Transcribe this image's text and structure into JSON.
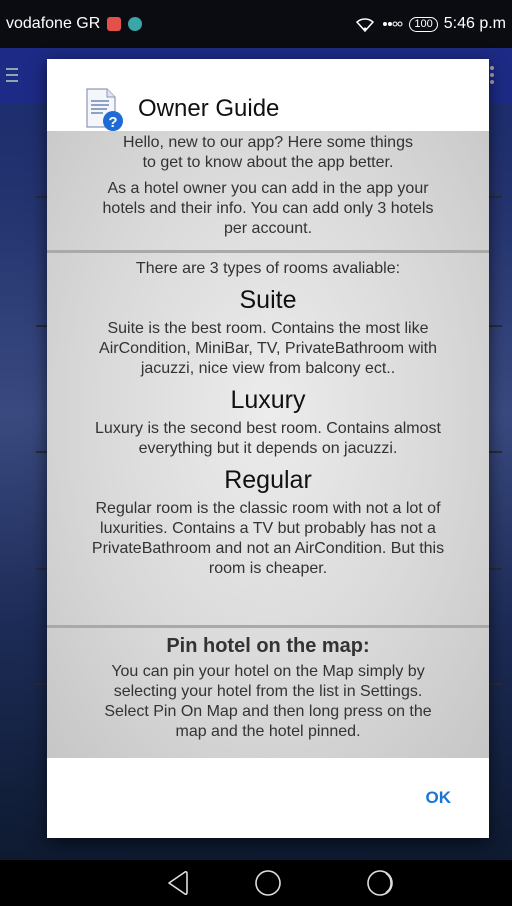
{
  "status_bar": {
    "carrier": "vodafone GR",
    "battery": "100",
    "time": "5:46 p.m"
  },
  "dialog": {
    "title": "Owner Guide",
    "intro": {
      "line1": "Hello, new to our app? Here some things",
      "line2": "to get to know about the app better.",
      "hotels_line1": "As a hotel owner you can add in the app your",
      "hotels_line2": "hotels and their info. You can add only 3 hotels",
      "hotels_line3": "per account."
    },
    "rooms": {
      "heading": "There are 3 types of rooms avaliable:",
      "suite": {
        "name": "Suite",
        "line1": "Suite is the best room. Contains the most like",
        "line2": "AirCondition, MiniBar, TV, PrivateBathroom with",
        "line3": "jacuzzi, nice view from balcony ect.."
      },
      "luxury": {
        "name": "Luxury",
        "line1": "Luxury is the second best room. Contains almost",
        "line2": "everything but it depends on jacuzzi."
      },
      "regular": {
        "name": "Regular",
        "line1": "Regular room is the classic room with not a lot of",
        "line2": "luxurities. Contains a TV but probably has not a",
        "line3": "PrivateBathroom and not an AirCondition. But this",
        "line4": "room is cheaper."
      }
    },
    "pin": {
      "title": "Pin hotel on the map:",
      "line1": "You can pin your hotel on the Map simply by",
      "line2": "selecting your hotel from the list in Settings.",
      "line3": "Select Pin On Map and then long press on the",
      "line4": "map and the hotel pinned."
    },
    "ok_label": "OK"
  },
  "colors": {
    "accent": "#1976d2",
    "toolbar": "#1d2b86"
  },
  "icons": {
    "dialog": "document-help-icon",
    "nav_back": "back-triangle-icon",
    "nav_home": "home-circle-icon",
    "nav_recents": "recents-icon"
  }
}
